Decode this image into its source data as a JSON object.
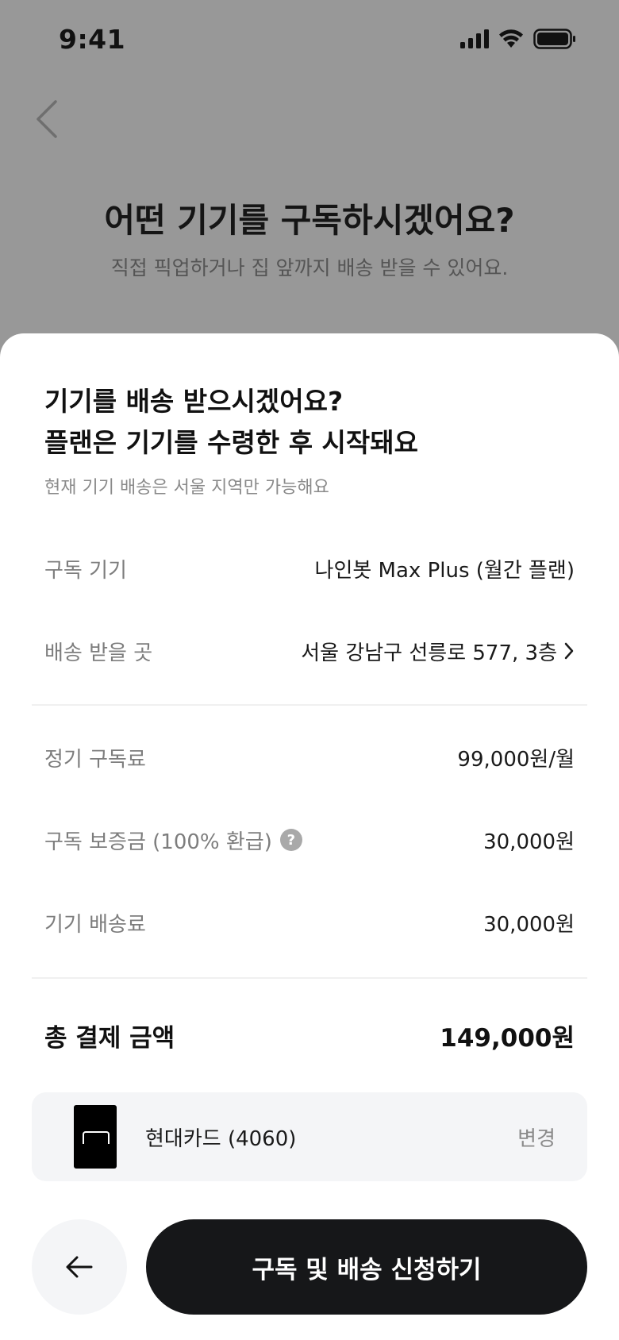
{
  "status_bar": {
    "time": "9:41",
    "icons": [
      "signal-icon",
      "wifi-icon",
      "battery-icon"
    ]
  },
  "background_page": {
    "title": "어떤 기기를 구독하시겠어요?",
    "subtitle": "직접 픽업하거나 집 앞까지 배송 받을 수 있어요."
  },
  "sheet": {
    "title_line1": "기기를 배송 받으시겠어요?",
    "title_line2": "플랜은 기기를 수령한 후 시작돼요",
    "note": "현재 기기 배송은 서울 지역만 가능해요",
    "rows": [
      {
        "label": "구독 기기",
        "value": "나인봇 Max Plus (월간 플랜)"
      },
      {
        "label": "배송 받을 곳",
        "value": "서울 강남구 선릉로 577, 3층"
      },
      {
        "label": "정기 구독료",
        "value": "99,000원/월"
      },
      {
        "label": "구독 보증금 (100% 환급)",
        "value": "30,000원"
      },
      {
        "label": "기기 배송료",
        "value": "30,000원"
      }
    ],
    "help_icon_glyph": "?",
    "total": {
      "label": "총 결제 금액",
      "value": "149,000원"
    },
    "payment": {
      "card_name": "현대카드 (4060)",
      "change_label": "변경"
    },
    "submit_label": "구독 및 배송 신청하기"
  },
  "colors": {
    "overlay": "#989898",
    "sheet_bg": "#ffffff",
    "primary_button": "#161719",
    "secondary_bg": "#f4f5f7"
  }
}
